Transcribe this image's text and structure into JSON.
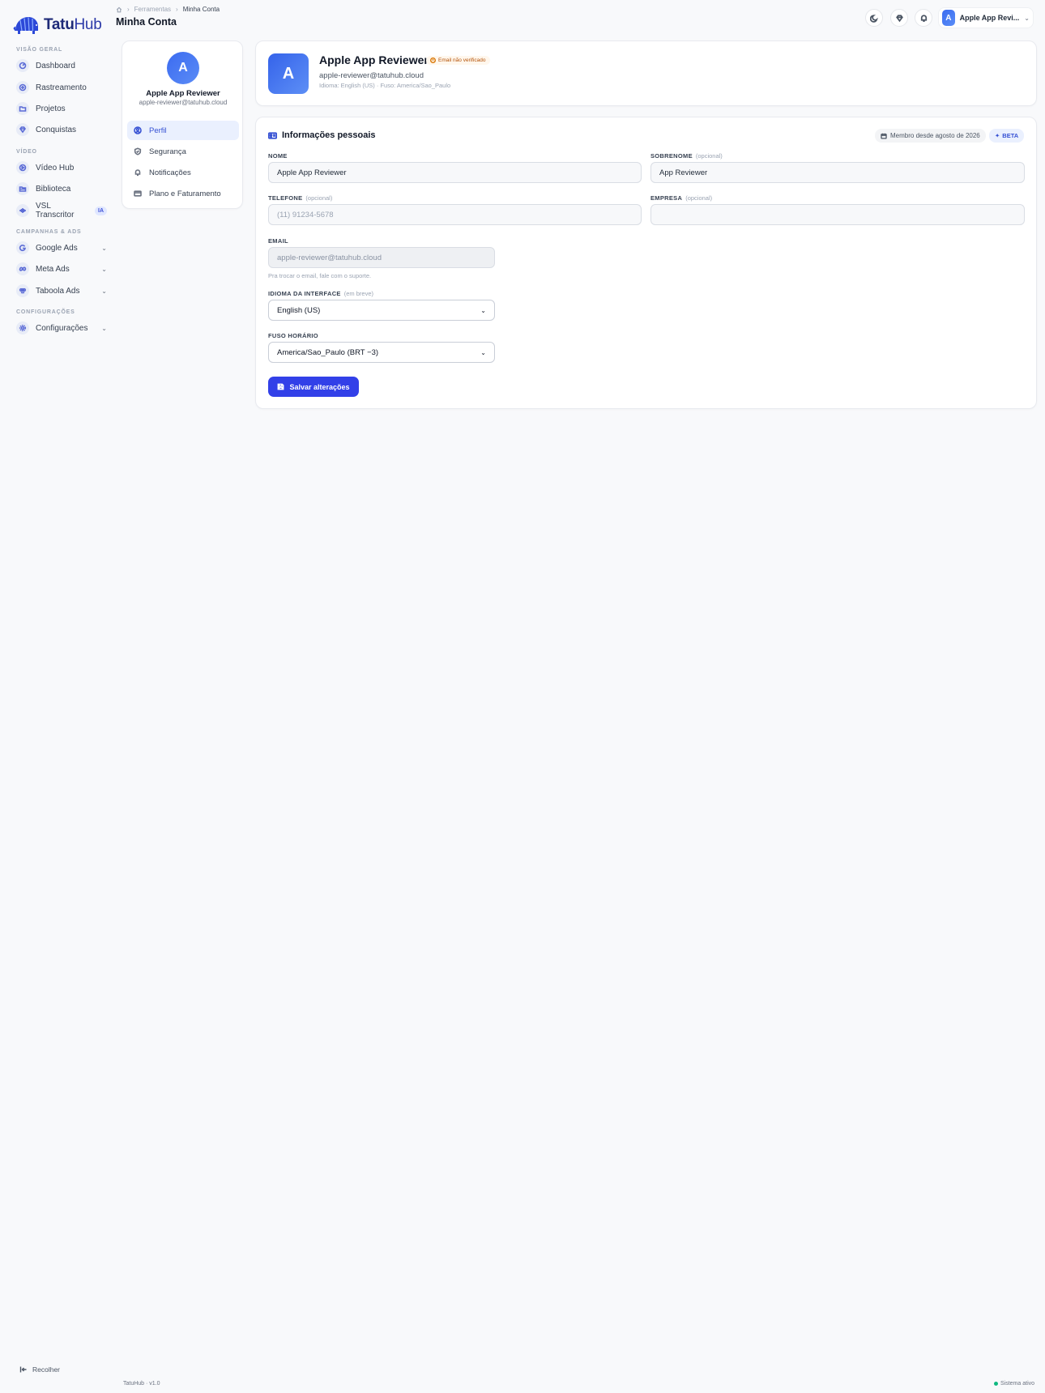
{
  "brand": {
    "name_bold": "Tatu",
    "name_light": "Hub"
  },
  "sidebar": {
    "sections": [
      {
        "title": "VISÃO GERAL",
        "items": [
          {
            "label": "Dashboard",
            "icon": "dashboard-icon"
          },
          {
            "label": "Rastreamento",
            "icon": "target-icon"
          },
          {
            "label": "Projetos",
            "icon": "folder-icon"
          },
          {
            "label": "Conquistas",
            "icon": "diamond-icon"
          }
        ]
      },
      {
        "title": "VÍDEO",
        "items": [
          {
            "label": "Vídeo Hub",
            "icon": "play-icon"
          },
          {
            "label": "Biblioteca",
            "icon": "folder-open-icon"
          },
          {
            "label": "VSL Transcritor",
            "icon": "audio-wave-icon",
            "badge": "IA"
          }
        ]
      },
      {
        "title": "CAMPANHAS & ADS",
        "items": [
          {
            "label": "Google Ads",
            "icon": "google-icon"
          },
          {
            "label": "Meta Ads",
            "icon": "meta-icon"
          },
          {
            "label": "Taboola Ads",
            "icon": "taboola-icon"
          }
        ]
      },
      {
        "title": "CONFIGURAÇÕES",
        "items": [
          {
            "label": "Configurações",
            "icon": "gear-icon"
          }
        ]
      }
    ],
    "collapse_label": "Recolher"
  },
  "header": {
    "breadcrumb": [
      "Ferramentas",
      "Minha Conta"
    ],
    "title": "Minha Conta",
    "user": {
      "initial": "A",
      "name": "Apple App Revi..."
    }
  },
  "profile_card": {
    "initial": "A",
    "name": "Apple App Reviewer",
    "email": "apple-reviewer@tatuhub.cloud",
    "menu": [
      {
        "label": "Perfil",
        "icon": "user-circle-icon",
        "active": true
      },
      {
        "label": "Segurança",
        "icon": "shield-icon"
      },
      {
        "label": "Notificações",
        "icon": "bell-icon"
      },
      {
        "label": "Plano e Faturamento",
        "icon": "credit-card-icon"
      }
    ]
  },
  "summary": {
    "initial": "A",
    "name": "Apple App Reviewer",
    "warning": "Email não verificado",
    "email": "apple-reviewer@tatuhub.cloud",
    "meta": "Idioma: English (US) · Fuso: America/Sao_Paulo"
  },
  "form": {
    "title": "Informações pessoais",
    "member_since": "Membro desde agosto de 2026",
    "beta": "BETA",
    "fields": {
      "nome": {
        "label": "NOME",
        "value": "Apple App Reviewer"
      },
      "sobrenome": {
        "label": "SOBRENOME",
        "optional": "(opcional)",
        "value": "App Reviewer"
      },
      "telefone": {
        "label": "TELEFONE",
        "optional": "(opcional)",
        "placeholder": "(11) 91234-5678"
      },
      "empresa": {
        "label": "EMPRESA",
        "optional": "(opcional)",
        "placeholder": ""
      },
      "email": {
        "label": "EMAIL",
        "value": "apple-reviewer@tatuhub.cloud",
        "hint": "Pra trocar o email, fale com o suporte."
      },
      "idioma": {
        "label": "IDIOMA DA INTERFACE",
        "optional": "(em breve)",
        "value": "English (US)"
      },
      "fuso": {
        "label": "FUSO HORÁRIO",
        "value": "America/Sao_Paulo (BRT −3)"
      }
    },
    "save_label": "Salvar alterações"
  },
  "footer": {
    "version": "TatuHub · v1.0",
    "status": "Sistema ativo"
  },
  "colors": {
    "accent": "#3240e8",
    "brand": "#1e2a78",
    "status_ok": "#10b981",
    "warning": "#b45309"
  }
}
